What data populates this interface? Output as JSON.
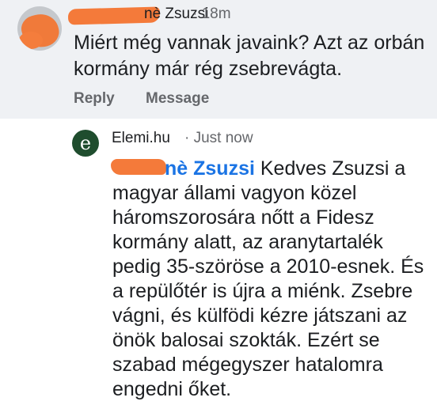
{
  "top_comment": {
    "author_visible": "nè Zsuzsi",
    "time": "18m",
    "text": "Miért még vannak javaink? Azt az orbán kormány már rég zsebrevágta.",
    "actions": {
      "reply": "Reply",
      "message": "Message"
    }
  },
  "reply_comment": {
    "avatar_letter": "e",
    "author": "Elemi.hu",
    "separator": "·",
    "time": "Just now",
    "mention_visible": "nè Zsuzsi",
    "text": " Kedves Zsuzsi a magyar állami vagyon közel háromszorosára nőtt a Fidesz kormány alatt, az aranytartalék pedig 35-szöröse a 2010-esnek. És a repülőtér is újra a miénk. Zsebre vágni, és külfödi kézre játszani az önök balosai szokták. Ezért se szabad mégegyszer hatalomra engedni őket."
  },
  "colors": {
    "top_bg": "#eff1f4",
    "mention": "#1b74e4",
    "redaction": "#f47a3a",
    "avatar_bg": "#1f4d2e",
    "secondary_text": "#65676b"
  }
}
